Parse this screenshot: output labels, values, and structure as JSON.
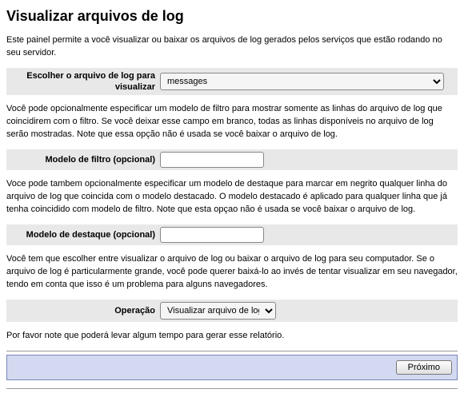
{
  "title": "Visualizar arquivos de log",
  "intro": "Este painel permite a você visualizar ou baixar os arquivos de log gerados pelos serviços que estão rodando no seu servidor.",
  "logfile": {
    "label": "Escolher o arquivo de log para visualizar",
    "value": "messages"
  },
  "filter_desc": "Você pode opcionalmente especificar um modelo de filtro para mostrar somente as linhas do arquivo de log que coincidirem com o filtro. Se você deixar esse campo em branco, todas as linhas disponíveis no arquivo de log serão mostradas. Note que essa opção não é usada se você baixar o arquivo de log.",
  "filter": {
    "label": "Modelo de filtro (opcional)",
    "value": ""
  },
  "highlight_desc": "Voce pode tambem opcionalmente especificar um modelo de destaque para marcar em negrito qualquer linha do arquivo de log que coincida com o modelo destacado. O modelo destacado é aplicado para qualquer linha que já tenha coincidido com modelo de filtro. Note que esta opçao não é usada se você baixar o arquivo de log.",
  "highlight": {
    "label": "Modelo de destaque (opcional)",
    "value": ""
  },
  "operation_desc": "Você tem que escolher entre visualizar o arquivo de log ou baixar o arquivo de log para seu computador. Se o arquivo de log é particularmente grande, você pode querer baixá-lo ao invés de tentar visualizar em seu navegador, tendo em conta que isso é um problema para alguns navegadores.",
  "operation": {
    "label": "Operação",
    "value": "Visualizar arquivo de log"
  },
  "footer_note": "Por favor note que poderá levar algum tempo para gerar esse relatório.",
  "next_button": "Próximo"
}
